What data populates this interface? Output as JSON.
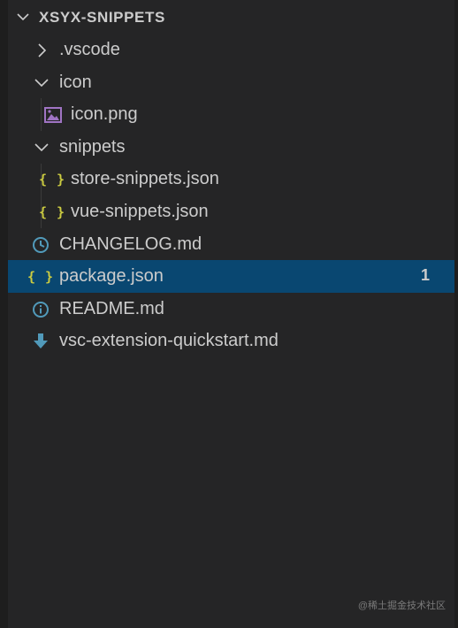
{
  "explorer": {
    "section_title": "XSYX-SNIPPETS",
    "items": [
      {
        "label": ".vscode",
        "type": "folder",
        "expanded": false,
        "depth": 0
      },
      {
        "label": "icon",
        "type": "folder",
        "expanded": true,
        "depth": 0
      },
      {
        "label": "icon.png",
        "type": "image",
        "depth": 1,
        "icon": "image-file-icon"
      },
      {
        "label": "snippets",
        "type": "folder",
        "expanded": true,
        "depth": 0
      },
      {
        "label": "store-snippets.json",
        "type": "json",
        "depth": 1,
        "icon": "json-braces-icon"
      },
      {
        "label": "vue-snippets.json",
        "type": "json",
        "depth": 1,
        "icon": "json-braces-icon"
      },
      {
        "label": "CHANGELOG.md",
        "type": "markdown",
        "depth": 0,
        "icon": "clock-icon"
      },
      {
        "label": "package.json",
        "type": "json",
        "depth": 0,
        "icon": "json-braces-icon",
        "selected": true,
        "badge": "1"
      },
      {
        "label": "README.md",
        "type": "markdown",
        "depth": 0,
        "icon": "info-icon"
      },
      {
        "label": "vsc-extension-quickstart.md",
        "type": "markdown",
        "depth": 0,
        "icon": "download-arrow-icon"
      }
    ],
    "json_glyph": "{ }"
  },
  "colors": {
    "background": "#252526",
    "selected_row": "#094771",
    "text": "#cccccc",
    "json_icon": "#cbcb41",
    "image_icon": "#a074c4",
    "changelog_icon": "#519aba",
    "readme_icon": "#519aba",
    "quickstart_icon": "#519aba"
  },
  "watermark": "@稀土掘金技术社区"
}
